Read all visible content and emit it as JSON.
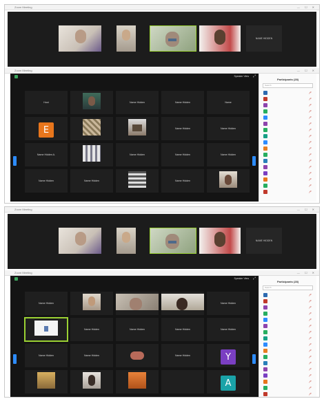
{
  "app": {
    "window_title": "Zoom Meeting",
    "controls": "—  ☐  ✕"
  },
  "speaker_strip": {
    "name_tile_label": "NAME HIDDEN",
    "captions": [
      "",
      "",
      "",
      ""
    ]
  },
  "gallery_a": {
    "view_button": "Speaker View",
    "cells": [
      "Host",
      "",
      "Name Hidden",
      "Name Hidden",
      "Name",
      "E",
      "",
      "",
      "Name Hidden",
      "Name Hidden",
      "Name Hidden A.",
      "",
      "Name Hidden",
      "Name Hidden",
      "Name Hidden",
      "Name Hidden",
      "Name Hidden",
      "",
      "Name Hidden",
      ""
    ]
  },
  "gallery_b": {
    "view_button": "Speaker View",
    "cells": [
      "Name Hidden",
      "",
      "",
      "",
      "Name Hidden",
      "",
      "Name Hidden",
      "Name Hidden",
      "Name Hidden",
      "Name Hidden",
      "Name Hidden",
      "Name Hidden",
      "",
      "Name Hidden",
      "Y",
      "",
      "",
      "",
      "",
      "A"
    ]
  },
  "participants": {
    "title": "Participants (28)",
    "search_placeholder": "Search",
    "rows": [
      "",
      "",
      "",
      "",
      "",
      "",
      "",
      "",
      "",
      "",
      "",
      "",
      "",
      "",
      "",
      "",
      ""
    ]
  },
  "colors": {
    "accent": "#2d8cff",
    "selected": "#9bd233",
    "avatar_e": "#e8761c",
    "avatar_y": "#7a3fc2",
    "avatar_a": "#1aa3a8"
  }
}
